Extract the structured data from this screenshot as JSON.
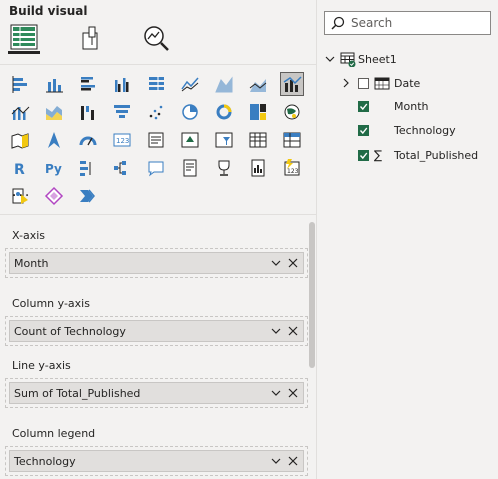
{
  "build_visual": {
    "title": "Build visual"
  },
  "modes": [
    {
      "name": "build-visual-mode",
      "icon": "table-grid-icon",
      "selected": true
    },
    {
      "name": "format-visual-mode",
      "icon": "paintbrush-icon",
      "selected": false
    },
    {
      "name": "analytics-mode",
      "icon": "magnifier-chart-icon",
      "selected": false
    }
  ],
  "visuals": [
    "stacked-bar-chart-icon",
    "stacked-column-chart-icon",
    "clustered-bar-chart-icon",
    "clustered-column-chart-icon",
    "100-stacked-bar-chart-icon",
    "line-chart-icon",
    "area-chart-icon",
    "stacked-area-chart-icon",
    "line-and-stacked-column-chart-icon",
    "line-and-clustered-column-chart-icon",
    "ribbon-chart-icon",
    "waterfall-chart-icon",
    "funnel-chart-icon",
    "scatter-chart-icon",
    "pie-chart-icon",
    "donut-chart-icon",
    "treemap-icon",
    "map-icon",
    "filled-map-icon",
    "azure-map-icon",
    "gauge-icon",
    "card-icon",
    "multi-row-card-icon",
    "kpi-icon",
    "slicer-icon",
    "table-icon",
    "matrix-icon",
    "r-visual-icon",
    "python-visual-icon",
    "key-influencers-icon",
    "decomposition-tree-icon",
    "qa-icon",
    "smart-narrative-icon",
    "metrics-icon",
    "paginated-report-icon",
    "power-automate-icon",
    "power-apps-icon",
    "power-apps-alt-icon",
    "more-visuals-icon"
  ],
  "more_label": "···",
  "wells": [
    {
      "label": "X-axis",
      "field": "Month"
    },
    {
      "label": "Column y-axis",
      "field": "Count of Technology"
    },
    {
      "label": "Line y-axis",
      "field": "Sum of Total_Published"
    },
    {
      "label": "Column legend",
      "field": "Technology"
    }
  ],
  "data_pane": {
    "search_placeholder": "Search",
    "table_name": "Sheet1",
    "fields": [
      {
        "label": "Date",
        "checked": false,
        "icon": "calendar-icon",
        "expandable": true
      },
      {
        "label": "Month",
        "checked": true,
        "icon": "",
        "expandable": false
      },
      {
        "label": "Technology",
        "checked": true,
        "icon": "",
        "expandable": false
      },
      {
        "label": "Total_Published",
        "checked": true,
        "icon": "sigma-icon",
        "expandable": false
      }
    ]
  },
  "colors": {
    "checkbox": "#216b47",
    "accent_yellow": "#f2c811",
    "accent_blue": "#3a7ec1"
  }
}
